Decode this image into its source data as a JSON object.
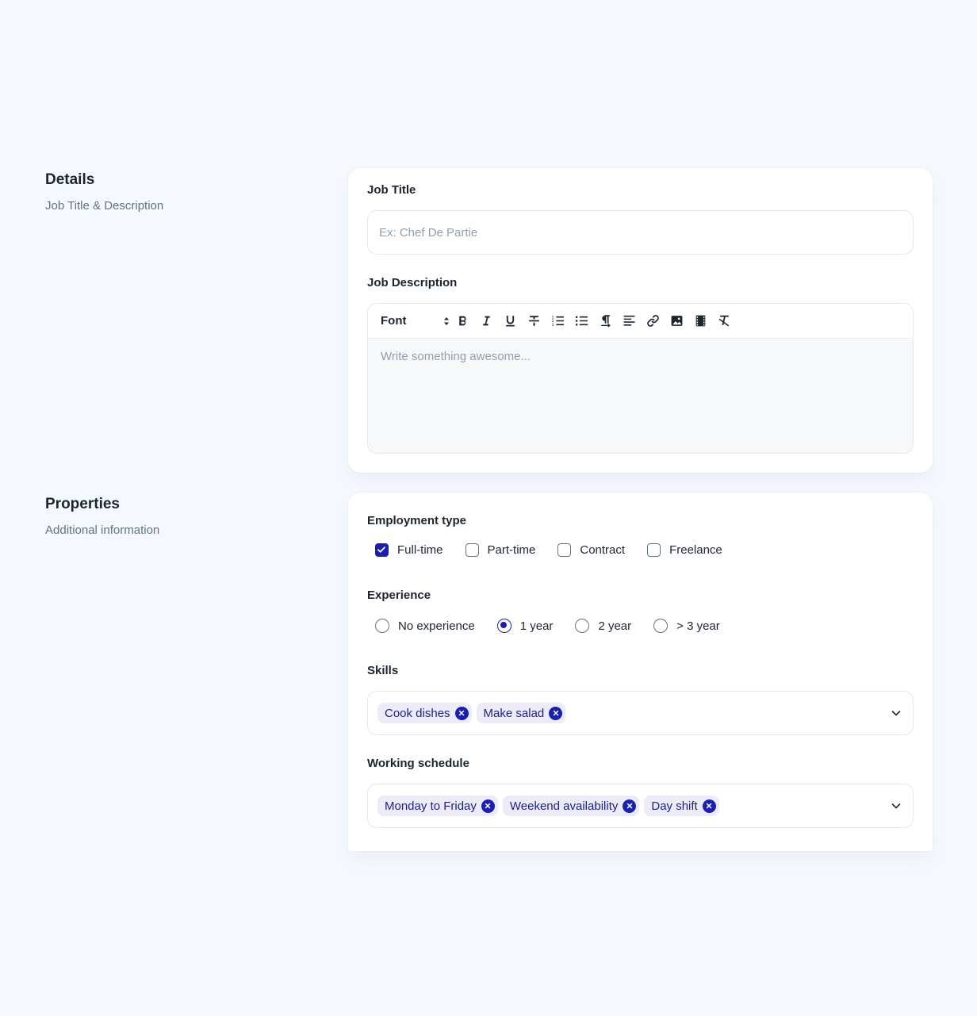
{
  "details": {
    "title": "Details",
    "subtitle": "Job Title & Description",
    "job_title_label": "Job Title",
    "job_title_placeholder": "Ex: Chef De Partie",
    "job_desc_label": "Job Description",
    "editor": {
      "font_label": "Font",
      "placeholder": "Write something awesome...",
      "tools": [
        "bold-icon",
        "italic-icon",
        "underline-icon",
        "strikethrough-icon",
        "ordered-list-icon",
        "bullet-list-icon",
        "paragraph-icon",
        "align-left-icon",
        "link-icon",
        "image-icon",
        "video-icon",
        "clear-format-icon"
      ]
    }
  },
  "properties": {
    "title": "Properties",
    "subtitle": "Additional information",
    "employment": {
      "label": "Employment type",
      "options": [
        {
          "label": "Full-time",
          "checked": true
        },
        {
          "label": "Part-time",
          "checked": false
        },
        {
          "label": "Contract",
          "checked": false
        },
        {
          "label": "Freelance",
          "checked": false
        }
      ]
    },
    "experience": {
      "label": "Experience",
      "options": [
        {
          "label": "No experience",
          "checked": false
        },
        {
          "label": "1 year",
          "checked": true
        },
        {
          "label": "2 year",
          "checked": false
        },
        {
          "label": "> 3 year",
          "checked": false
        }
      ]
    },
    "skills": {
      "label": "Skills",
      "chips": [
        "Cook dishes",
        "Make salad"
      ]
    },
    "schedule": {
      "label": "Working schedule",
      "chips": [
        "Monday to Friday",
        "Weekend availability",
        "Day shift"
      ]
    }
  },
  "colors": {
    "accent": "#1a1fb3",
    "chip_bg": "#ebecf7",
    "page_bg": "#f5f9fe"
  }
}
